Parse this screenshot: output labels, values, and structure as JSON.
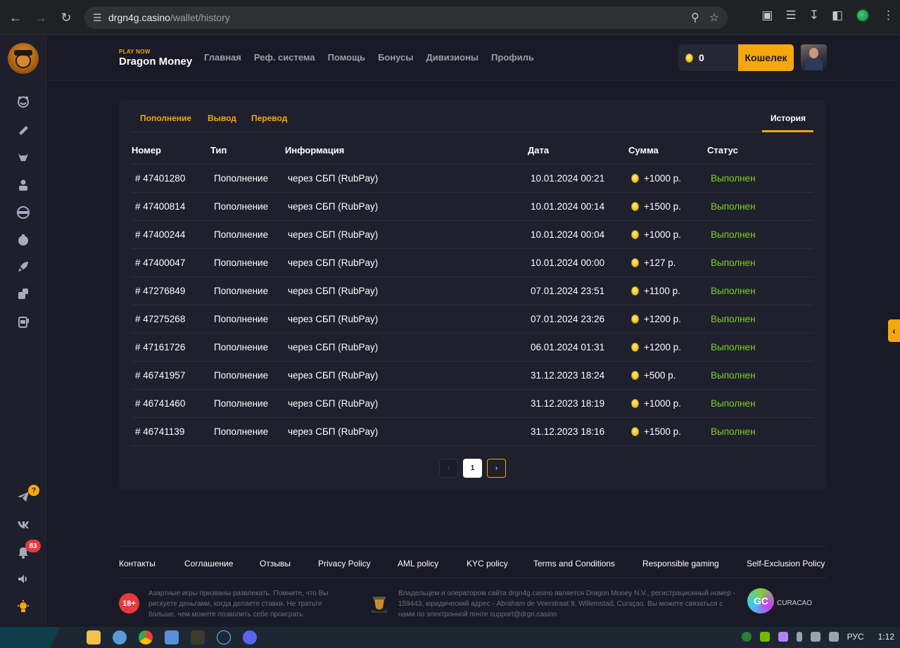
{
  "browser": {
    "url_host": "drgn4g.casino",
    "url_path": "/wallet/history"
  },
  "brand": {
    "tagline": "PLAY NOW",
    "name": "Dragon Money"
  },
  "topnav": [
    "Главная",
    "Реф. система",
    "Помощь",
    "Бонусы",
    "Дивизионы",
    "Профиль"
  ],
  "header": {
    "balance": "0",
    "wallet_label": "Кошелек"
  },
  "sidebar": {
    "icons": [
      "smile-icon",
      "ticket-icon",
      "bull-icon",
      "player-icon",
      "wheel-icon",
      "coinflip-icon",
      "rocket-icon",
      "dice-icon",
      "slot-icon"
    ],
    "telegram_badge": "?",
    "notifications_count": "83"
  },
  "tabs": {
    "deposit": "Пополнение",
    "withdraw": "Вывод",
    "transfer": "Перевод",
    "history": "История"
  },
  "table": {
    "columns": [
      "Номер",
      "Тип",
      "Информация",
      "Дата",
      "Сумма",
      "Статус"
    ],
    "rows": [
      {
        "id": "# 47401280",
        "type": "Пополнение",
        "info": "через СБП (RubPay)",
        "date": "10.01.2024 00:21",
        "amount": "+1000 р.",
        "status": "Выполнен"
      },
      {
        "id": "# 47400814",
        "type": "Пополнение",
        "info": "через СБП (RubPay)",
        "date": "10.01.2024 00:14",
        "amount": "+1500 р.",
        "status": "Выполнен"
      },
      {
        "id": "# 47400244",
        "type": "Пополнение",
        "info": "через СБП (RubPay)",
        "date": "10.01.2024 00:04",
        "amount": "+1000 р.",
        "status": "Выполнен"
      },
      {
        "id": "# 47400047",
        "type": "Пополнение",
        "info": "через СБП (RubPay)",
        "date": "10.01.2024 00:00",
        "amount": "+127 р.",
        "status": "Выполнен"
      },
      {
        "id": "# 47276849",
        "type": "Пополнение",
        "info": "через СБП (RubPay)",
        "date": "07.01.2024 23:51",
        "amount": "+1100 р.",
        "status": "Выполнен"
      },
      {
        "id": "# 47275268",
        "type": "Пополнение",
        "info": "через СБП (RubPay)",
        "date": "07.01.2024 23:26",
        "amount": "+1200 р.",
        "status": "Выполнен"
      },
      {
        "id": "# 47161726",
        "type": "Пополнение",
        "info": "через СБП (RubPay)",
        "date": "06.01.2024 01:31",
        "amount": "+1200 р.",
        "status": "Выполнен"
      },
      {
        "id": "# 46741957",
        "type": "Пополнение",
        "info": "через СБП (RubPay)",
        "date": "31.12.2023 18:24",
        "amount": "+500 р.",
        "status": "Выполнен"
      },
      {
        "id": "# 46741460",
        "type": "Пополнение",
        "info": "через СБП (RubPay)",
        "date": "31.12.2023 18:19",
        "amount": "+1000 р.",
        "status": "Выполнен"
      },
      {
        "id": "# 46741139",
        "type": "Пополнение",
        "info": "через СБП (RubPay)",
        "date": "31.12.2023 18:16",
        "amount": "+1500 р.",
        "status": "Выполнен"
      }
    ]
  },
  "pagination": {
    "current": "1"
  },
  "footer": {
    "links": [
      "Контакты",
      "Соглашение",
      "Отзывы",
      "Privacy Policy",
      "AML policy",
      "KYC policy",
      "Terms and Conditions",
      "Responsible gaming",
      "Self-Exclusion Policy"
    ],
    "age": "18+",
    "disclaimer": "Азартные игры призваны развлекать. Помните, что Вы рискуете деньгами, когда делаете ставки. Не тратьте больше, чем можете позволить себе проиграть.",
    "owner": "Владельцем и оператором сайта drgn4g.casino является Dragon Money N.V., регистрационный номер - 159443, юридический адрес - Abraham de Veerstraat 9, Willemstad, Curaçao. Вы можете связаться с нами по электронной почте support@drgn.casino",
    "gc_label": "GC",
    "curacao_label": "CURACAO"
  },
  "taskbar": {
    "lang": "РУС",
    "time": "1:12"
  },
  "colors": {
    "accent": "#f5a70d",
    "success": "#7ed321",
    "bg": "#191a25",
    "card": "#1f202d"
  }
}
